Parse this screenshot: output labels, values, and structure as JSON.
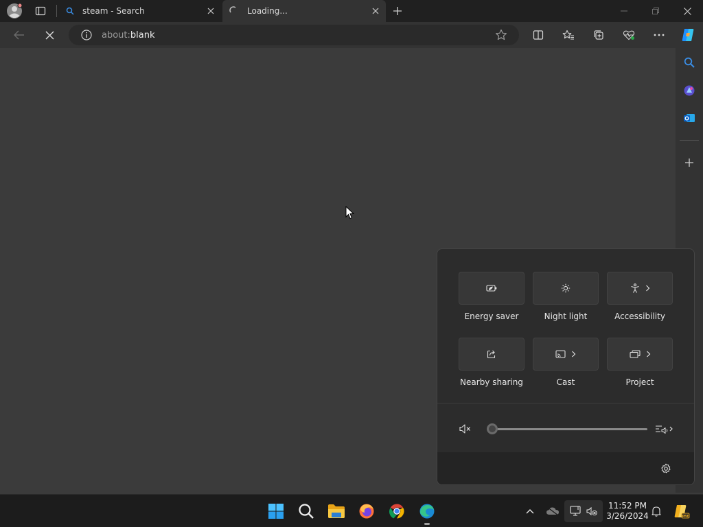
{
  "tabs": [
    {
      "title": "steam - Search",
      "icon": "search-icon"
    },
    {
      "title": "Loading...",
      "icon": "loading-spinner-icon"
    }
  ],
  "address_bar": {
    "url_prefix": "about:",
    "url_host": "blank"
  },
  "quick_settings": {
    "tiles": [
      {
        "label": "Energy saver",
        "icon": "energy-saver-icon"
      },
      {
        "label": "Night light",
        "icon": "night-light-icon"
      },
      {
        "label": "Accessibility",
        "icon": "accessibility-icon"
      },
      {
        "label": "Nearby sharing",
        "icon": "share-icon"
      },
      {
        "label": "Cast",
        "icon": "cast-icon"
      },
      {
        "label": "Project",
        "icon": "project-icon"
      }
    ],
    "volume_level": 0
  },
  "taskbar": {
    "time": "11:52 PM",
    "date": "3/26/2024"
  },
  "colors": {
    "accent_blue": "#0078d4",
    "copilot_blue": "#1e90ff"
  }
}
